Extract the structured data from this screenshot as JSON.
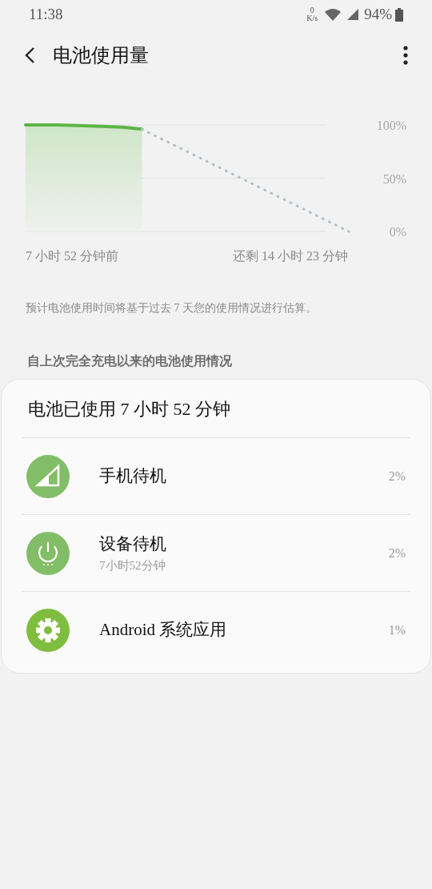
{
  "status_bar": {
    "time": "11:38",
    "speed_value": "0",
    "speed_unit": "K/s",
    "battery": "94%"
  },
  "header": {
    "title": "电池使用量"
  },
  "chart": {
    "y_labels": [
      "100%",
      "50%",
      "0%"
    ],
    "start_label": "7 小时 52 分钟前",
    "end_label": "还剩 14 小时 23 分钟"
  },
  "note": "预计电池使用时间将基于过去 7 天您的使用情况进行估算。",
  "section_title": "自上次完全充电以来的电池使用情况",
  "usage": {
    "title": "电池已使用 7 小时 52 分钟",
    "items": [
      {
        "kind": "signal",
        "name": "手机待机",
        "percent": "2%"
      },
      {
        "kind": "power",
        "name": "设备待机",
        "detail": "7小时52分钟",
        "percent": "2%"
      },
      {
        "kind": "system",
        "name": "Android 系统应用",
        "percent": "1%"
      }
    ]
  }
}
